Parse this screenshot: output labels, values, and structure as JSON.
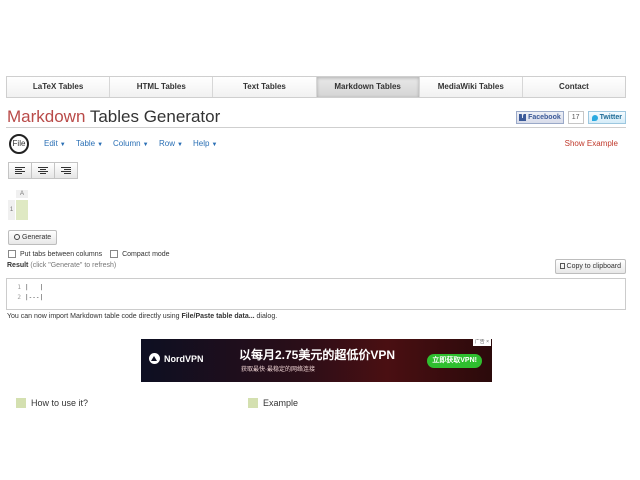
{
  "topnav": {
    "tabs": [
      {
        "label": "LaTeX Tables",
        "active": false
      },
      {
        "label": "HTML Tables",
        "active": false
      },
      {
        "label": "Text Tables",
        "active": false
      },
      {
        "label": "Markdown Tables",
        "active": true
      },
      {
        "label": "MediaWiki Tables",
        "active": false
      },
      {
        "label": "Contact",
        "active": false
      }
    ]
  },
  "header": {
    "title_accent": "Markdown",
    "title_rest": " Tables Generator",
    "facebook_label": "Facebook",
    "facebook_icon": "facebook-icon",
    "facebook_count": "17",
    "twitter_label": "Twitter",
    "twitter_icon": "twitter-icon"
  },
  "menubar": {
    "file": "File",
    "edit": "Edit",
    "table": "Table",
    "column": "Column",
    "row": "Row",
    "help": "Help",
    "show_example": "Show Example"
  },
  "grid": {
    "column_label": "A",
    "row_label": "1"
  },
  "controls": {
    "generate_label": "Generate",
    "tabs_option": "Put tabs between columns",
    "compact_option": "Compact mode",
    "result_label": "Result",
    "result_hint": "(click \"Generate\" to refresh)",
    "copy_label": "Copy to clipboard"
  },
  "code": {
    "lines": [
      {
        "num": "1",
        "text": "|   |"
      },
      {
        "num": "2",
        "text": "|---|"
      }
    ]
  },
  "import_note": {
    "prefix": "You can now import Markdown table code directly using ",
    "bold": "File/Paste table data...",
    "suffix": " dialog."
  },
  "ad": {
    "brand": "NordVPN",
    "headline": "以每月2.75美元的超低价VPN",
    "subline": "获取最快·最稳定的网络连接",
    "cta": "立即获取VPN!",
    "tag": "广告 ×"
  },
  "sections": {
    "how_to": "How to use it?",
    "example": "Example"
  },
  "colors": {
    "accent": "#b94a48",
    "link": "#2a6fb5",
    "cell_highlight": "#dfe9c3"
  }
}
